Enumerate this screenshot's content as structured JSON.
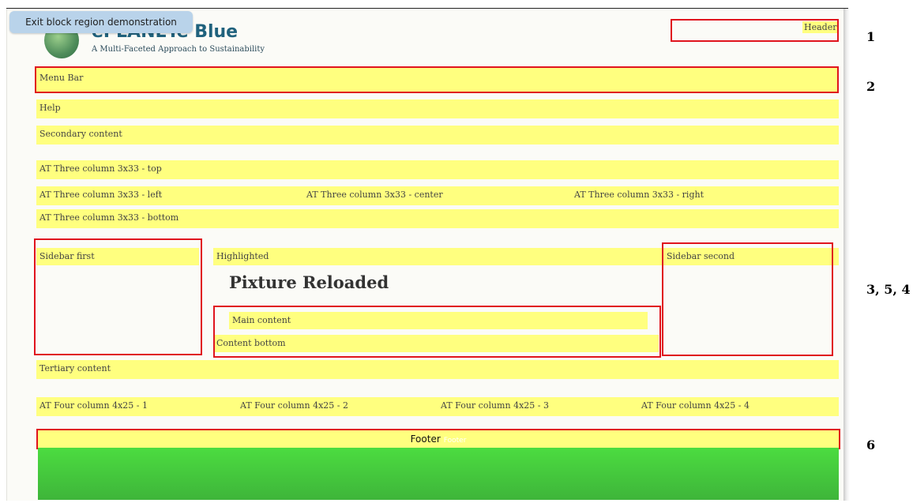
{
  "exit_button": "Exit block region demonstration",
  "site": {
    "name": "ePLANETe Blue",
    "slogan": "A Multi-Faceted Approach to Sustainability"
  },
  "regions": {
    "header": "Header",
    "menu_bar": "Menu Bar",
    "help": "Help",
    "secondary_content": "Secondary content",
    "three_col_top": "AT Three column 3x33 - top",
    "three_col_left": "AT Three column 3x33 - left",
    "three_col_center": "AT Three column 3x33 - center",
    "three_col_right": "AT Three column 3x33 - right",
    "three_col_bottom": "AT Three column 3x33 - bottom",
    "sidebar_first": "Sidebar first",
    "highlighted": "Highlighted",
    "sidebar_second": "Sidebar second",
    "main_content": "Main content",
    "content_bottom": "Content bottom",
    "tertiary_content": "Tertiary content",
    "four_col_1": "AT Four column 4x25 - 1",
    "four_col_2": "AT Four column 4x25 - 2",
    "four_col_3": "AT Four column 4x25 - 3",
    "four_col_4": "AT Four column 4x25 - 4",
    "footer": "Footer",
    "footer_ghost": "Footer"
  },
  "page_title": "Pixture Reloaded",
  "annotations": {
    "n1": "1",
    "n2": "2",
    "n3": "3, 5, 4",
    "n6": "6"
  },
  "colors": {
    "region_fill": "#ffff7f",
    "highlight_border": "#e0141e",
    "footer_green": "#44c93c",
    "site_name": "#20627d"
  }
}
